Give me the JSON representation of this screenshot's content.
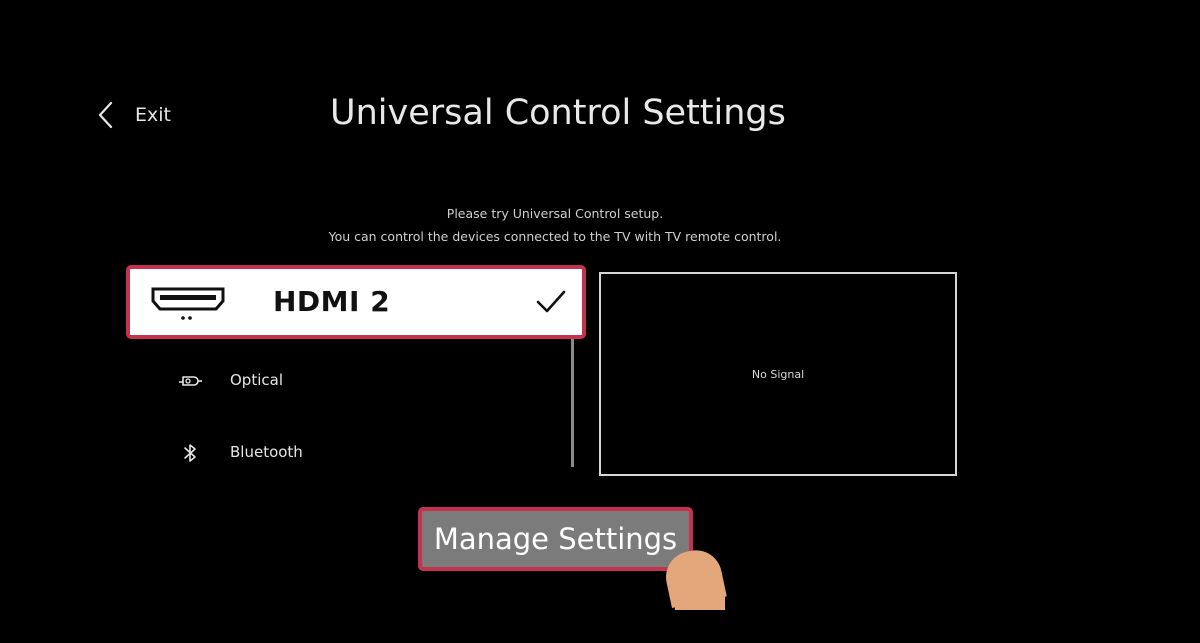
{
  "header": {
    "exit_label": "Exit",
    "title": "Universal Control Settings"
  },
  "hint": {
    "line1": "Please try Universal Control setup.",
    "line2": "You can control the devices connected to the TV with TV remote control."
  },
  "devices": [
    {
      "label": "HDMI 2",
      "icon": "hdmi-icon",
      "selected": true
    },
    {
      "label": "Optical",
      "icon": "optical-icon",
      "selected": false
    },
    {
      "label": "Bluetooth",
      "icon": "bluetooth-icon",
      "selected": false
    }
  ],
  "preview": {
    "status": "No Signal"
  },
  "actions": {
    "manage_label": "Manage Settings"
  },
  "colors": {
    "background": "#000000",
    "focus_border": "#c3334f",
    "button_bg": "#7b7b7b",
    "selected_bg": "#ffffff"
  }
}
